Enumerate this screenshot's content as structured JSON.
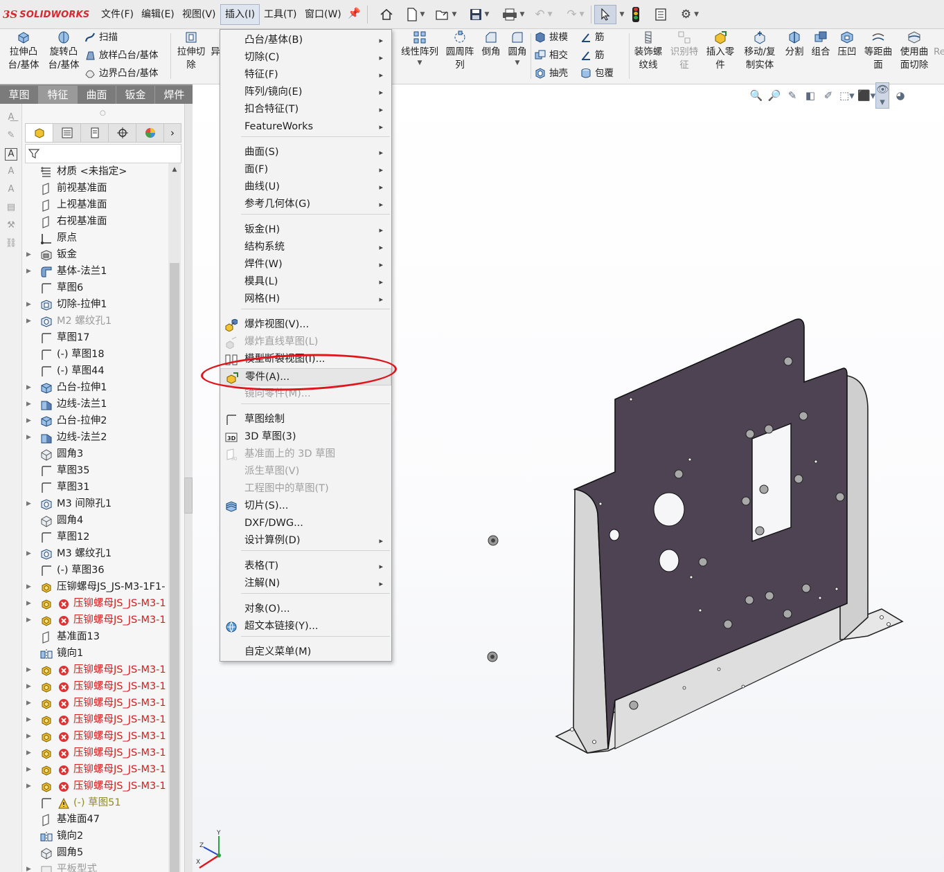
{
  "app": {
    "logo_ds": "3S",
    "logo_text": "SOLIDWORKS"
  },
  "menubar": {
    "items": [
      "文件(F)",
      "编辑(E)",
      "视图(V)",
      "插入(I)",
      "工具(T)",
      "窗口(W)"
    ],
    "active_index": 3
  },
  "quick_access": [
    "home-icon",
    "new-document-icon",
    "open-icon",
    "save-icon",
    "print-icon",
    "undo-icon",
    "redo-icon",
    "select-pointer-icon",
    "traffic-light-icon",
    "file-properties-icon",
    "options-gear-icon"
  ],
  "command_manager": {
    "extrude_boss": "拉伸凸\n台/基体",
    "revolve_boss": "旋转凸\n台/基体",
    "sweep": "扫描",
    "loft": "放样凸台/基体",
    "boundary": "边界凸台/基体",
    "extrude_cut": "拉伸切\n除",
    "hole": "异",
    "linear_pattern": "线性阵列",
    "circular_pattern": "圆周阵\n列",
    "chamfer": "倒角",
    "fillet": "圆角",
    "draft": "拔模",
    "intersect": "相交",
    "shell": "抽壳",
    "rib1": "筋",
    "rib2": "筋",
    "wrap": "包覆",
    "cosmetic_thread": "装饰螺\n纹线",
    "recognize_features": "识别特\n征",
    "insert_part": "插入零\n件",
    "move_copy": "移动/复\n制实体",
    "split": "分割",
    "combine": "组合",
    "indent": "压凹",
    "offset_surface": "等距曲\n面",
    "surface_cut": "使用曲\n面切除",
    "more": "Re"
  },
  "tabs": [
    "草图",
    "特征",
    "曲面",
    "钣金",
    "焊件",
    "直接"
  ],
  "active_tab": 1,
  "feature_tree": [
    {
      "label": "材质 <未指定>",
      "icon": "material-icon",
      "style": "normal",
      "expand": false
    },
    {
      "label": "前视基准面",
      "icon": "plane-icon",
      "style": "normal",
      "expand": false
    },
    {
      "label": "上视基准面",
      "icon": "plane-icon",
      "style": "normal",
      "expand": false
    },
    {
      "label": "右视基准面",
      "icon": "plane-icon",
      "style": "normal",
      "expand": false
    },
    {
      "label": "原点",
      "icon": "origin-icon",
      "style": "normal",
      "expand": false
    },
    {
      "label": "钣金",
      "icon": "sheet-metal-icon",
      "style": "normal",
      "expand": true
    },
    {
      "label": "基体-法兰1",
      "icon": "base-flange-icon",
      "style": "normal",
      "expand": true
    },
    {
      "label": "草图6",
      "icon": "sketch-icon",
      "style": "normal",
      "expand": false
    },
    {
      "label": "切除-拉伸1",
      "icon": "cut-extrude-icon",
      "style": "normal",
      "expand": true
    },
    {
      "label": "M2 螺纹孔1",
      "icon": "hole-icon",
      "style": "gray",
      "expand": true
    },
    {
      "label": "草图17",
      "icon": "sketch-icon",
      "style": "normal",
      "expand": false
    },
    {
      "label": "(-) 草图18",
      "icon": "sketch-icon",
      "style": "normal",
      "expand": false
    },
    {
      "label": "(-) 草图44",
      "icon": "sketch-icon",
      "style": "normal",
      "expand": false
    },
    {
      "label": "凸台-拉伸1",
      "icon": "boss-extrude-icon",
      "style": "normal",
      "expand": true
    },
    {
      "label": "边线-法兰1",
      "icon": "edge-flange-icon",
      "style": "normal",
      "expand": true
    },
    {
      "label": "凸台-拉伸2",
      "icon": "boss-extrude-icon",
      "style": "normal",
      "expand": true
    },
    {
      "label": "边线-法兰2",
      "icon": "edge-flange-icon",
      "style": "normal",
      "expand": true
    },
    {
      "label": "圆角3",
      "icon": "fillet-icon",
      "style": "normal",
      "expand": false
    },
    {
      "label": "草图35",
      "icon": "sketch-icon",
      "style": "normal",
      "expand": false
    },
    {
      "label": "草图31",
      "icon": "sketch-icon",
      "style": "normal",
      "expand": false
    },
    {
      "label": "M3 间隙孔1",
      "icon": "hole-icon",
      "style": "normal",
      "expand": true
    },
    {
      "label": "圆角4",
      "icon": "fillet-icon",
      "style": "normal",
      "expand": false
    },
    {
      "label": "草图12",
      "icon": "sketch-icon",
      "style": "normal",
      "expand": false
    },
    {
      "label": "M3 螺纹孔1",
      "icon": "hole-icon",
      "style": "normal",
      "expand": true
    },
    {
      "label": "(-) 草图36",
      "icon": "sketch-icon",
      "style": "normal",
      "expand": false
    },
    {
      "label": "压铆螺母JS_JS-M3-1F1-",
      "icon": "part-insert-icon",
      "style": "normal",
      "expand": true
    },
    {
      "label": "压铆螺母JS_JS-M3-1",
      "icon": "part-insert-icon",
      "style": "red",
      "expand": true
    },
    {
      "label": "压铆螺母JS_JS-M3-1",
      "icon": "part-insert-icon",
      "style": "red",
      "expand": true
    },
    {
      "label": "基准面13",
      "icon": "plane-icon",
      "style": "normal",
      "expand": false
    },
    {
      "label": "镜向1",
      "icon": "mirror-icon",
      "style": "normal",
      "expand": false
    },
    {
      "label": "压铆螺母JS_JS-M3-1",
      "icon": "part-insert-icon",
      "style": "red",
      "expand": true
    },
    {
      "label": "压铆螺母JS_JS-M3-1",
      "icon": "part-insert-icon",
      "style": "red",
      "expand": true
    },
    {
      "label": "压铆螺母JS_JS-M3-1",
      "icon": "part-insert-icon",
      "style": "red",
      "expand": true
    },
    {
      "label": "压铆螺母JS_JS-M3-1",
      "icon": "part-insert-icon",
      "style": "red",
      "expand": true
    },
    {
      "label": "压铆螺母JS_JS-M3-1",
      "icon": "part-insert-icon",
      "style": "red",
      "expand": true
    },
    {
      "label": "压铆螺母JS_JS-M3-1",
      "icon": "part-insert-icon",
      "style": "red",
      "expand": true
    },
    {
      "label": "压铆螺母JS_JS-M3-1",
      "icon": "part-insert-icon",
      "style": "red",
      "expand": true
    },
    {
      "label": "压铆螺母JS_JS-M3-1",
      "icon": "part-insert-icon",
      "style": "red",
      "expand": true
    },
    {
      "label": "(-) 草图51",
      "icon": "sketch-icon",
      "style": "warn",
      "expand": false
    },
    {
      "label": "基准面47",
      "icon": "plane-icon",
      "style": "normal",
      "expand": false
    },
    {
      "label": "镜向2",
      "icon": "mirror-icon",
      "style": "normal",
      "expand": false
    },
    {
      "label": "圆角5",
      "icon": "fillet-icon",
      "style": "normal",
      "expand": false
    },
    {
      "label": "平板型式",
      "icon": "flat-pattern-icon",
      "style": "gray",
      "expand": true
    }
  ],
  "insert_menu": {
    "items": [
      {
        "label": "凸台/基体(B)",
        "sub": true
      },
      {
        "label": "切除(C)",
        "sub": true
      },
      {
        "label": "特征(F)",
        "sub": true
      },
      {
        "label": "阵列/镜向(E)",
        "sub": true
      },
      {
        "label": "扣合特征(T)",
        "sub": true
      },
      {
        "label": "FeatureWorks",
        "sub": true
      },
      {
        "label": "曲面(S)",
        "sub": true
      },
      {
        "label": "面(F)",
        "sub": true
      },
      {
        "label": "曲线(U)",
        "sub": true
      },
      {
        "label": "参考几何体(G)",
        "sub": true
      },
      {
        "label": "钣金(H)",
        "sub": true
      },
      {
        "label": "结构系统",
        "sub": true
      },
      {
        "label": "焊件(W)",
        "sub": true
      },
      {
        "label": "模具(L)",
        "sub": true
      },
      {
        "label": "网格(H)",
        "sub": true
      },
      {
        "label": "爆炸视图(V)...",
        "icon": "exploded-view-icon"
      },
      {
        "label": "爆炸直线草图(L)",
        "icon": "explode-line-icon",
        "disabled": true
      },
      {
        "label": "模型断裂视图(I)...",
        "icon": "break-view-icon"
      },
      {
        "label": "零件(A)...",
        "icon": "insert-part-icon",
        "highlight": true
      },
      {
        "label": "镜向零件(M)...",
        "disabled": true
      },
      {
        "label": "草图绘制",
        "icon": "sketch-icon"
      },
      {
        "label": "3D 草图(3)",
        "icon": "sketch-3d-icon"
      },
      {
        "label": "基准面上的 3D 草图",
        "icon": "sketch-3d-plane-icon",
        "disabled": true
      },
      {
        "label": "派生草图(V)",
        "disabled": true
      },
      {
        "label": "工程图中的草图(T)",
        "disabled": true
      },
      {
        "label": "切片(S)...",
        "icon": "slice-icon"
      },
      {
        "label": "DXF/DWG..."
      },
      {
        "label": "设计算例(D)",
        "sub": true
      },
      {
        "label": "表格(T)",
        "sub": true
      },
      {
        "label": "注解(N)",
        "sub": true
      },
      {
        "label": "对象(O)..."
      },
      {
        "label": "超文本链接(Y)...",
        "icon": "hyperlink-icon"
      },
      {
        "label": "自定义菜单(M)"
      }
    ]
  },
  "triad": {
    "x": "X",
    "y": "Y",
    "z": "Z"
  },
  "colors": {
    "accent": "#d8282f",
    "plate": "#4d4353",
    "flange": "#d9d9d9",
    "annotation": "#e0141b"
  }
}
